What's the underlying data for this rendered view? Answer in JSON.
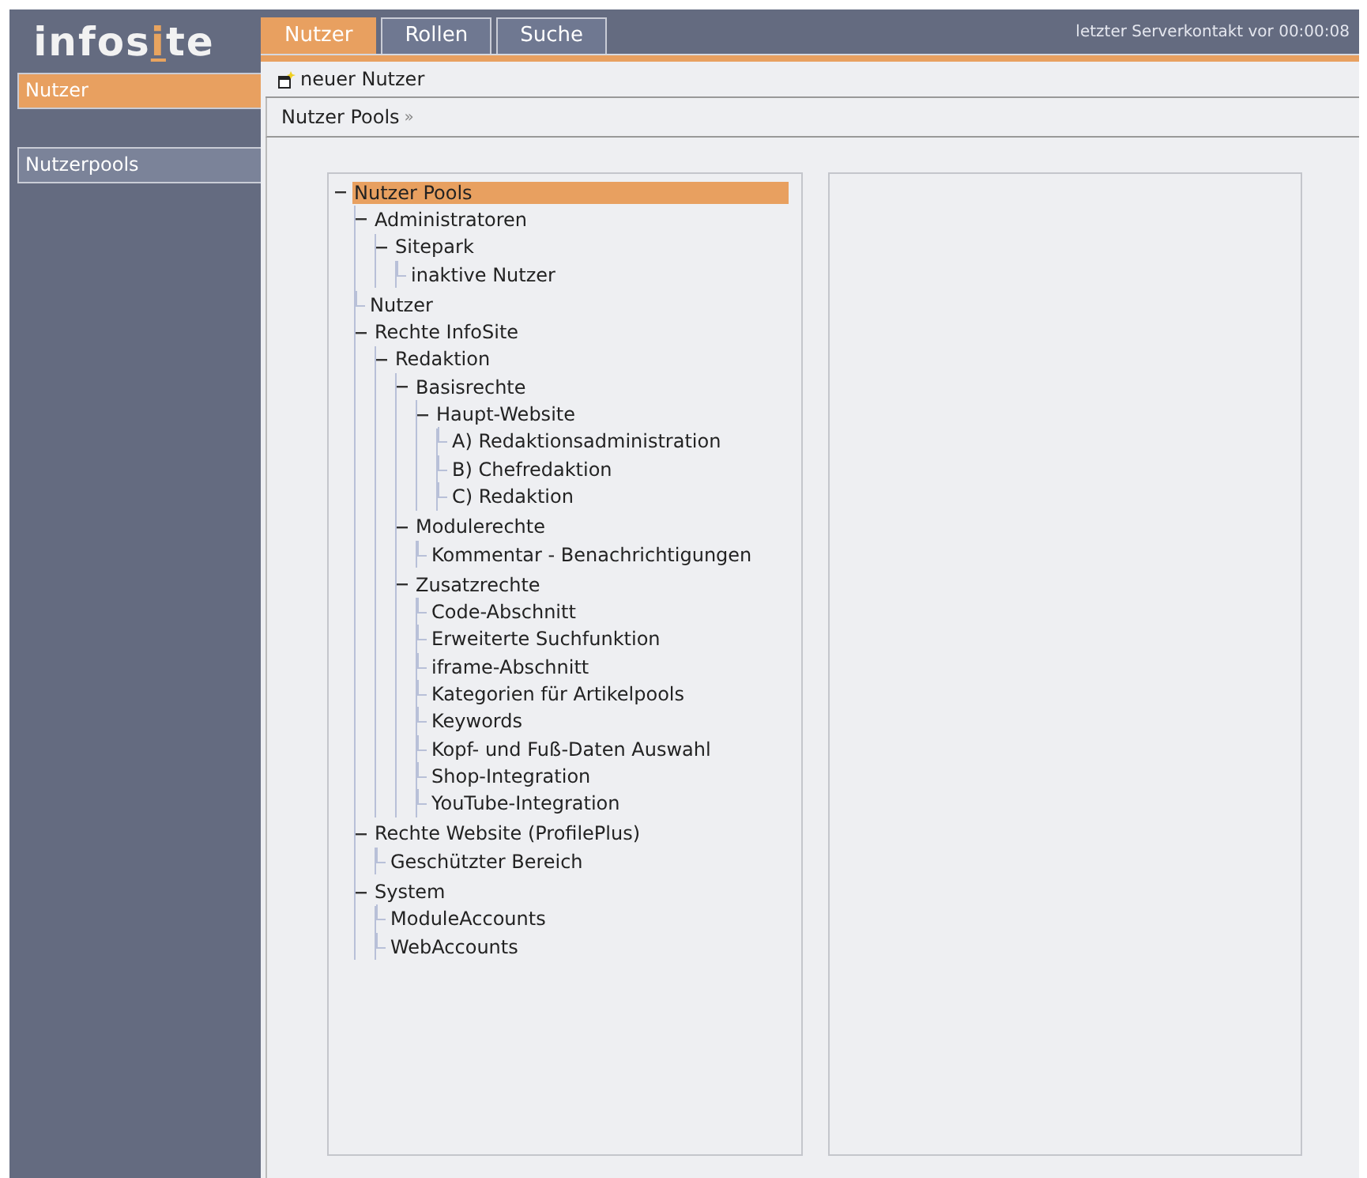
{
  "logo": {
    "before": "infos",
    "accent": "i",
    "after": "te"
  },
  "sidebar": {
    "items": [
      {
        "label": "Nutzer",
        "selected": true
      },
      {
        "label": "Nutzerpools",
        "selected": false
      }
    ]
  },
  "tabs": [
    {
      "label": "Nutzer",
      "selected": true
    },
    {
      "label": "Rollen",
      "selected": false
    },
    {
      "label": "Suche",
      "selected": false
    }
  ],
  "server_status": "letzter Serverkontakt vor 00:00:08",
  "toolbar": {
    "new_button": "neuer Nutzer"
  },
  "breadcrumb": {
    "label": "Nutzer Pools",
    "separator": "»"
  },
  "tree": [
    {
      "label": "Nutzer Pools",
      "selected": true,
      "expanded": true,
      "children": [
        {
          "label": "Administratoren",
          "selected": false,
          "expanded": true,
          "children": [
            {
              "label": "Sitepark",
              "selected": false,
              "expanded": true,
              "children": [
                {
                  "label": "inaktive Nutzer",
                  "selected": false
                }
              ]
            }
          ]
        },
        {
          "label": "Nutzer",
          "selected": false
        },
        {
          "label": "Rechte InfoSite",
          "selected": false,
          "expanded": true,
          "children": [
            {
              "label": "Redaktion",
              "selected": false,
              "expanded": true,
              "children": [
                {
                  "label": "Basisrechte",
                  "selected": false,
                  "expanded": true,
                  "children": [
                    {
                      "label": "Haupt-Website",
                      "selected": false,
                      "expanded": true,
                      "children": [
                        {
                          "label": "A) Redaktionsadministration",
                          "selected": false
                        },
                        {
                          "label": "B) Chefredaktion",
                          "selected": false
                        },
                        {
                          "label": "C) Redaktion",
                          "selected": false
                        }
                      ]
                    }
                  ]
                },
                {
                  "label": "Modulerechte",
                  "selected": false,
                  "expanded": true,
                  "children": [
                    {
                      "label": "Kommentar - Benachrichtigungen",
                      "selected": false
                    }
                  ]
                },
                {
                  "label": "Zusatzrechte",
                  "selected": false,
                  "expanded": true,
                  "children": [
                    {
                      "label": "Code-Abschnitt",
                      "selected": false
                    },
                    {
                      "label": "Erweiterte Suchfunktion",
                      "selected": false
                    },
                    {
                      "label": "iframe-Abschnitt",
                      "selected": false
                    },
                    {
                      "label": "Kategorien für Artikelpools",
                      "selected": false
                    },
                    {
                      "label": "Keywords",
                      "selected": false
                    },
                    {
                      "label": "Kopf- und Fuß-Daten Auswahl",
                      "selected": false
                    },
                    {
                      "label": "Shop-Integration",
                      "selected": false
                    },
                    {
                      "label": "YouTube-Integration",
                      "selected": false
                    }
                  ]
                }
              ]
            }
          ]
        },
        {
          "label": "Rechte Website (ProfilePlus)",
          "selected": false,
          "expanded": true,
          "children": [
            {
              "label": "Geschützter Bereich",
              "selected": false
            }
          ]
        },
        {
          "label": "System",
          "selected": false,
          "expanded": true,
          "children": [
            {
              "label": "ModuleAccounts",
              "selected": false
            },
            {
              "label": "WebAccounts",
              "selected": false
            }
          ]
        }
      ]
    }
  ]
}
